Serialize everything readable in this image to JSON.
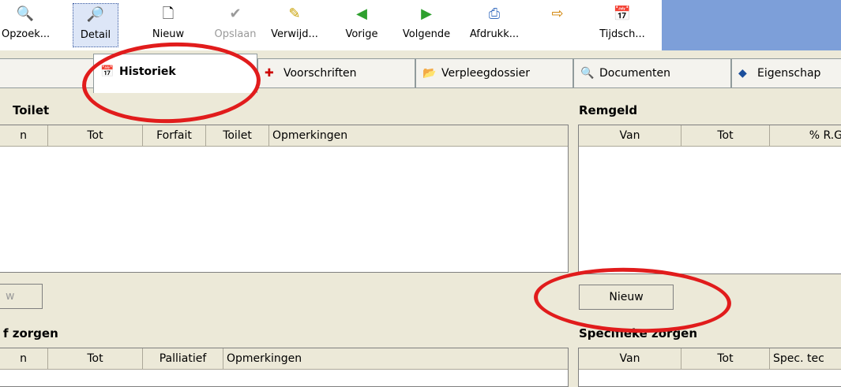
{
  "toolbar": {
    "opzoek": "Opzoek...",
    "detail": "Detail",
    "nieuw": "Nieuw",
    "opslaan": "Opslaan",
    "verwijderen": "Verwijd...",
    "vorige": "Vorige",
    "volgende": "Volgende",
    "afdrukken": "Afdrukk...",
    "tijdschema": "Tijdsch..."
  },
  "tabs": {
    "historiek": "Historiek",
    "voorschriften": "Voorschriften",
    "verpleegdossier": "Verpleegdossier",
    "documenten": "Documenten",
    "eigenschappen": "Eigenschap"
  },
  "toilet": {
    "title": "Toilet",
    "columns": [
      "n",
      "Tot",
      "Forfait",
      "Toilet",
      "Opmerkingen"
    ],
    "new_button": "w"
  },
  "remgeld": {
    "title": "Remgeld",
    "columns": [
      "Van",
      "Tot",
      "% R.G"
    ],
    "new_button": "Nieuw"
  },
  "palliatief": {
    "title": "f zorgen",
    "columns": [
      "n",
      "Tot",
      "Palliatief",
      "Opmerkingen"
    ]
  },
  "specifiek": {
    "title": "Specifieke zorgen",
    "columns": [
      "Van",
      "Tot",
      "Spec. tec"
    ]
  },
  "colors": {
    "highlight_ring": "#e11c1c",
    "toolbar_accent": "#7d9fd9"
  }
}
